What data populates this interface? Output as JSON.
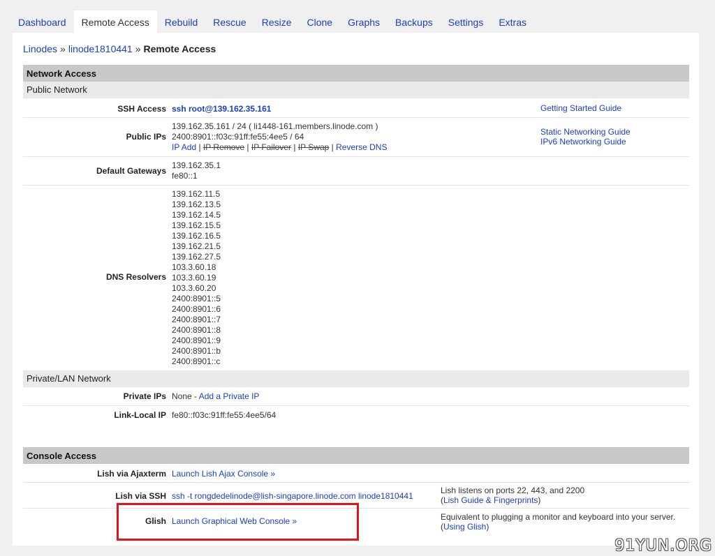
{
  "tabs": [
    {
      "label": "Dashboard"
    },
    {
      "label": "Remote Access"
    },
    {
      "label": "Rebuild"
    },
    {
      "label": "Rescue"
    },
    {
      "label": "Resize"
    },
    {
      "label": "Clone"
    },
    {
      "label": "Graphs"
    },
    {
      "label": "Backups"
    },
    {
      "label": "Settings"
    },
    {
      "label": "Extras"
    }
  ],
  "breadcrumb": {
    "root": "Linodes",
    "node": "linode1810441",
    "current": "Remote Access",
    "sep": "»"
  },
  "network": {
    "title": "Network Access",
    "public_title": "Public Network",
    "ssh": {
      "label": "SSH Access",
      "value": "ssh root@139.162.35.161",
      "guide": "Getting Started Guide"
    },
    "public_ips": {
      "label": "Public IPs",
      "lines": [
        "139.162.35.161 / 24 ( li1448-161.members.linode.com )",
        "2400:8901::f03c:91ff:fe55:4ee5 / 64"
      ],
      "actions": {
        "ip_add": "IP Add",
        "ip_remove": "IP Remove",
        "ip_failover": "IP Failover",
        "ip_swap": "IP Swap",
        "reverse_dns": "Reverse DNS",
        "sep": " | "
      },
      "guides": [
        "Static Networking Guide",
        "IPv6 Networking Guide"
      ]
    },
    "gateways": {
      "label": "Default Gateways",
      "lines": [
        "139.162.35.1",
        "fe80::1"
      ]
    },
    "dns": {
      "label": "DNS Resolvers",
      "lines": [
        "139.162.11.5",
        "139.162.13.5",
        "139.162.14.5",
        "139.162.15.5",
        "139.162.16.5",
        "139.162.21.5",
        "139.162.27.5",
        "103.3.60.18",
        "103.3.60.19",
        "103.3.60.20",
        "2400:8901::5",
        "2400:8901::6",
        "2400:8901::7",
        "2400:8901::8",
        "2400:8901::9",
        "2400:8901::b",
        "2400:8901::c"
      ]
    },
    "private_title": "Private/LAN Network",
    "private_ips": {
      "label": "Private IPs",
      "value": "None - ",
      "link": "Add a Private IP"
    },
    "link_local": {
      "label": "Link-Local IP",
      "value": "fe80::f03c:91ff:fe55:4ee5/64"
    }
  },
  "console": {
    "title": "Console Access",
    "ajax": {
      "label": "Lish via Ajaxterm",
      "link": "Launch Lish Ajax Console »"
    },
    "ssh": {
      "label": "Lish via SSH",
      "value": "ssh -t rongdedelinode@lish-singapore.linode.com linode1810441",
      "note": "Lish listens on ports 22, 443, and 2200",
      "note_link": "Lish Guide & Fingerprints"
    },
    "glish": {
      "label": "Glish",
      "link": "Launch Graphical Web Console »",
      "note": "Equivalent to plugging a monitor and keyboard into your server.",
      "note_link": "Using Glish"
    }
  },
  "watermark": "91YUN.ORG",
  "colors": {
    "link": "#1a3fbf",
    "highlight_box": "#e0141a",
    "section_header": "#c8c8c8"
  }
}
